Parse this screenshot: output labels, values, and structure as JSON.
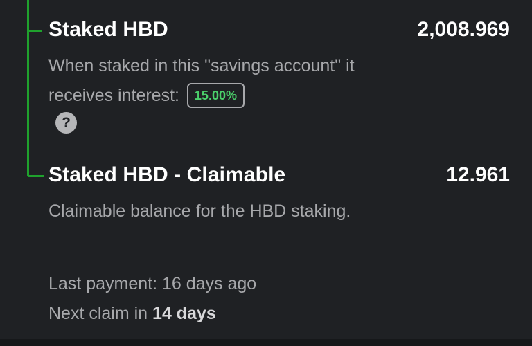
{
  "staked_hbd": {
    "title": "Staked HBD",
    "amount": "2,008.969",
    "description": "When staked in this \"savings account\" it receives interest:",
    "interest_badge": "15.00%",
    "help_icon": "question-icon",
    "help_glyph": "?"
  },
  "staked_hbd_claimable": {
    "title": "Staked HBD - Claimable",
    "amount": "12.961",
    "description": "Claimable balance for the HBD staking."
  },
  "payment_info": {
    "last_payment": "Last payment: 16 days ago",
    "next_claim_prefix": "Next claim in",
    "next_claim_value": "14 days"
  },
  "colors": {
    "background": "#1f2124",
    "tree_line": "#1fa12d",
    "badge_text": "#4bd06b",
    "secondary_text": "#a7a8ab"
  }
}
